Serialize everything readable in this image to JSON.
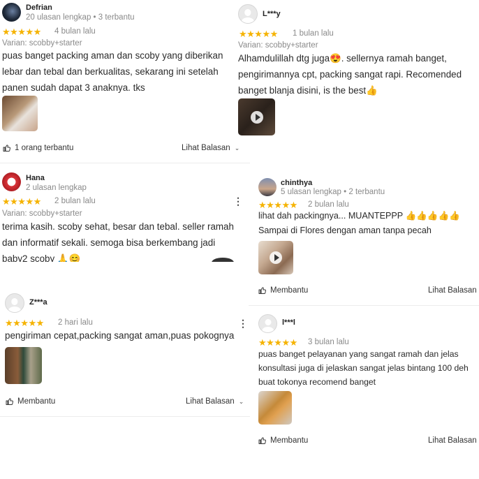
{
  "reviews": [
    {
      "name": "Defrian",
      "meta": "20 ulasan lengkap • 3 terbantu",
      "stars": "★★★★★",
      "time": "4 bulan lalu",
      "variant": "Varian: scobby+starter",
      "text": "puas banget packing aman dan scoby yang diberikan lebar dan tebal dan berkualitas, sekarang ini setelah panen sudah dapat 3 anaknya. tks",
      "helpful": "1 orang terbantu",
      "reply": "Lihat Balasan"
    },
    {
      "name": "L***y",
      "stars": "★★★★★",
      "time": "1 bulan lalu",
      "variant": "Varian: scobby+starter",
      "text": "Alhamdulillah dtg juga😍. sellernya ramah banget, pengirimannya cpt, packing sangat rapi. Recomended banget blanja disini, is the best👍"
    },
    {
      "name": "Hana",
      "meta": "2 ulasan lengkap",
      "stars": "★★★★★",
      "time": "2 bulan lalu",
      "variant": "Varian: scobby+starter",
      "text": "terima kasih. scoby sehat, besar dan tebal. seller ramah dan informatif sekali. semoga bisa berkembang jadi baby2 scoby 🙏😊"
    },
    {
      "name": "chinthya",
      "meta": "5 ulasan lengkap • 2 terbantu",
      "stars": "★★★★★",
      "time": "2 bulan lalu",
      "text": "lihat dah packingnya... MUANTEPPP 👍👍👍👍👍 Sampai di Flores dengan aman tanpa pecah",
      "helpful": "Membantu",
      "reply": "Lihat Balasan"
    },
    {
      "name": "Z***a",
      "stars": "★★★★★",
      "time": "2 hari lalu",
      "text": "pengiriman cepat,packing sangat aman,puas pokognya",
      "helpful": "Membantu",
      "reply": "Lihat Balasan"
    },
    {
      "name": "l***l",
      "stars": "★★★★★",
      "time": "3 bulan lalu",
      "text": "puas banget pelayanan yang sangat ramah dan jelas konsultasi juga di jelaskan sangat jelas bintang 100 deh buat tokonya recomend banget",
      "helpful": "Membantu",
      "reply": "Lihat Balasan"
    }
  ],
  "icons": {
    "thumbs_up": "thumbs-up-icon",
    "more": "more-vertical-icon",
    "play": "play-icon",
    "chevron": "chevron-down-icon"
  },
  "colors": {
    "star": "#f5b301",
    "muted": "#8a8a8a",
    "text": "#2a2a2a"
  }
}
